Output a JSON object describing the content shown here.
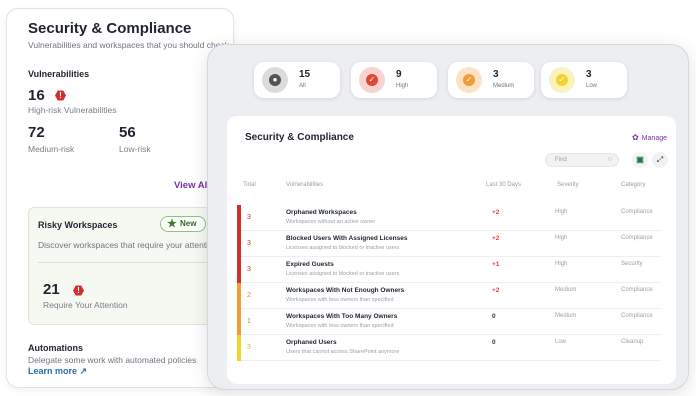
{
  "left_card": {
    "title": "Security & Compliance",
    "subtitle": "Vulnerabilities and workspaces that you should check",
    "vulnerabilities_heading": "Vulnerabilities",
    "high_risk_count": "16",
    "high_risk_label": "High-risk Vulnerabilities",
    "medium_risk_count": "72",
    "medium_risk_label": "Medium-risk",
    "low_risk_count": "56",
    "low_risk_label": "Low-risk",
    "view_all": "View All ›",
    "risky": {
      "title": "Risky Workspaces",
      "badge": "New",
      "subtitle": "Discover workspaces that require your attention",
      "count": "21",
      "count_label": "Require Your Attention"
    },
    "automations": {
      "heading": "Automations",
      "subtitle": "Delegate some work with automated policies",
      "learn_more": "Learn more ↗"
    }
  },
  "summary_pills": [
    {
      "count": "15",
      "label": "All",
      "color": "#555555",
      "bg": "#dcdcdc"
    },
    {
      "count": "9",
      "label": "High",
      "color": "#e0453a",
      "bg": "#f8d4d1"
    },
    {
      "count": "3",
      "label": "Medium",
      "color": "#f29c38",
      "bg": "#fde2c4"
    },
    {
      "count": "3",
      "label": "Low",
      "color": "#f2d52a",
      "bg": "#fbf3bd"
    }
  ],
  "panel": {
    "title": "Security & Compliance",
    "manage": "Manage",
    "search_placeholder": "Find",
    "headers": {
      "total": "Total",
      "vulnerabilities": "Vulnerabilities",
      "last30": "Last 30 Days",
      "severity": "Severity",
      "category": "Category"
    },
    "rows": [
      {
        "total": "3",
        "name": "Orphaned Workspaces",
        "desc": "Workspaces without an active owner",
        "last": "+2",
        "severity": "High",
        "category": "Compliance",
        "bar": "#d0312d"
      },
      {
        "total": "3",
        "name": "Blocked Users With Assigned Licenses",
        "desc": "Licenses assigned to blocked or inactive users",
        "last": "+2",
        "severity": "High",
        "category": "Compliance",
        "bar": "#d0312d"
      },
      {
        "total": "3",
        "name": "Expired Guests",
        "desc": "Licenses assigned to blocked or inactive users",
        "last": "+1",
        "severity": "High",
        "category": "Security",
        "bar": "#d0312d"
      },
      {
        "total": "2",
        "name": "Workspaces With Not Enough Owners",
        "desc": "Workspaces with less owners than specified",
        "last": "+2",
        "severity": "Medium",
        "category": "Compliance",
        "bar": "#f29c38"
      },
      {
        "total": "1",
        "name": "Workspaces With Too Many Owners",
        "desc": "Workspaces with less owners than specified",
        "last": "0",
        "severity": "Medium",
        "category": "Compliance",
        "bar": "#f29c38"
      },
      {
        "total": "3",
        "name": "Orphaned Users",
        "desc": "Users that cannot access SharePoint anymore",
        "last": "0",
        "severity": "Low",
        "category": "Cleanup",
        "bar": "#f2d52a"
      }
    ]
  },
  "colors": {
    "accent": "#7b2fa6",
    "danger": "#d0312d",
    "positive_delta": "#e0453a"
  }
}
